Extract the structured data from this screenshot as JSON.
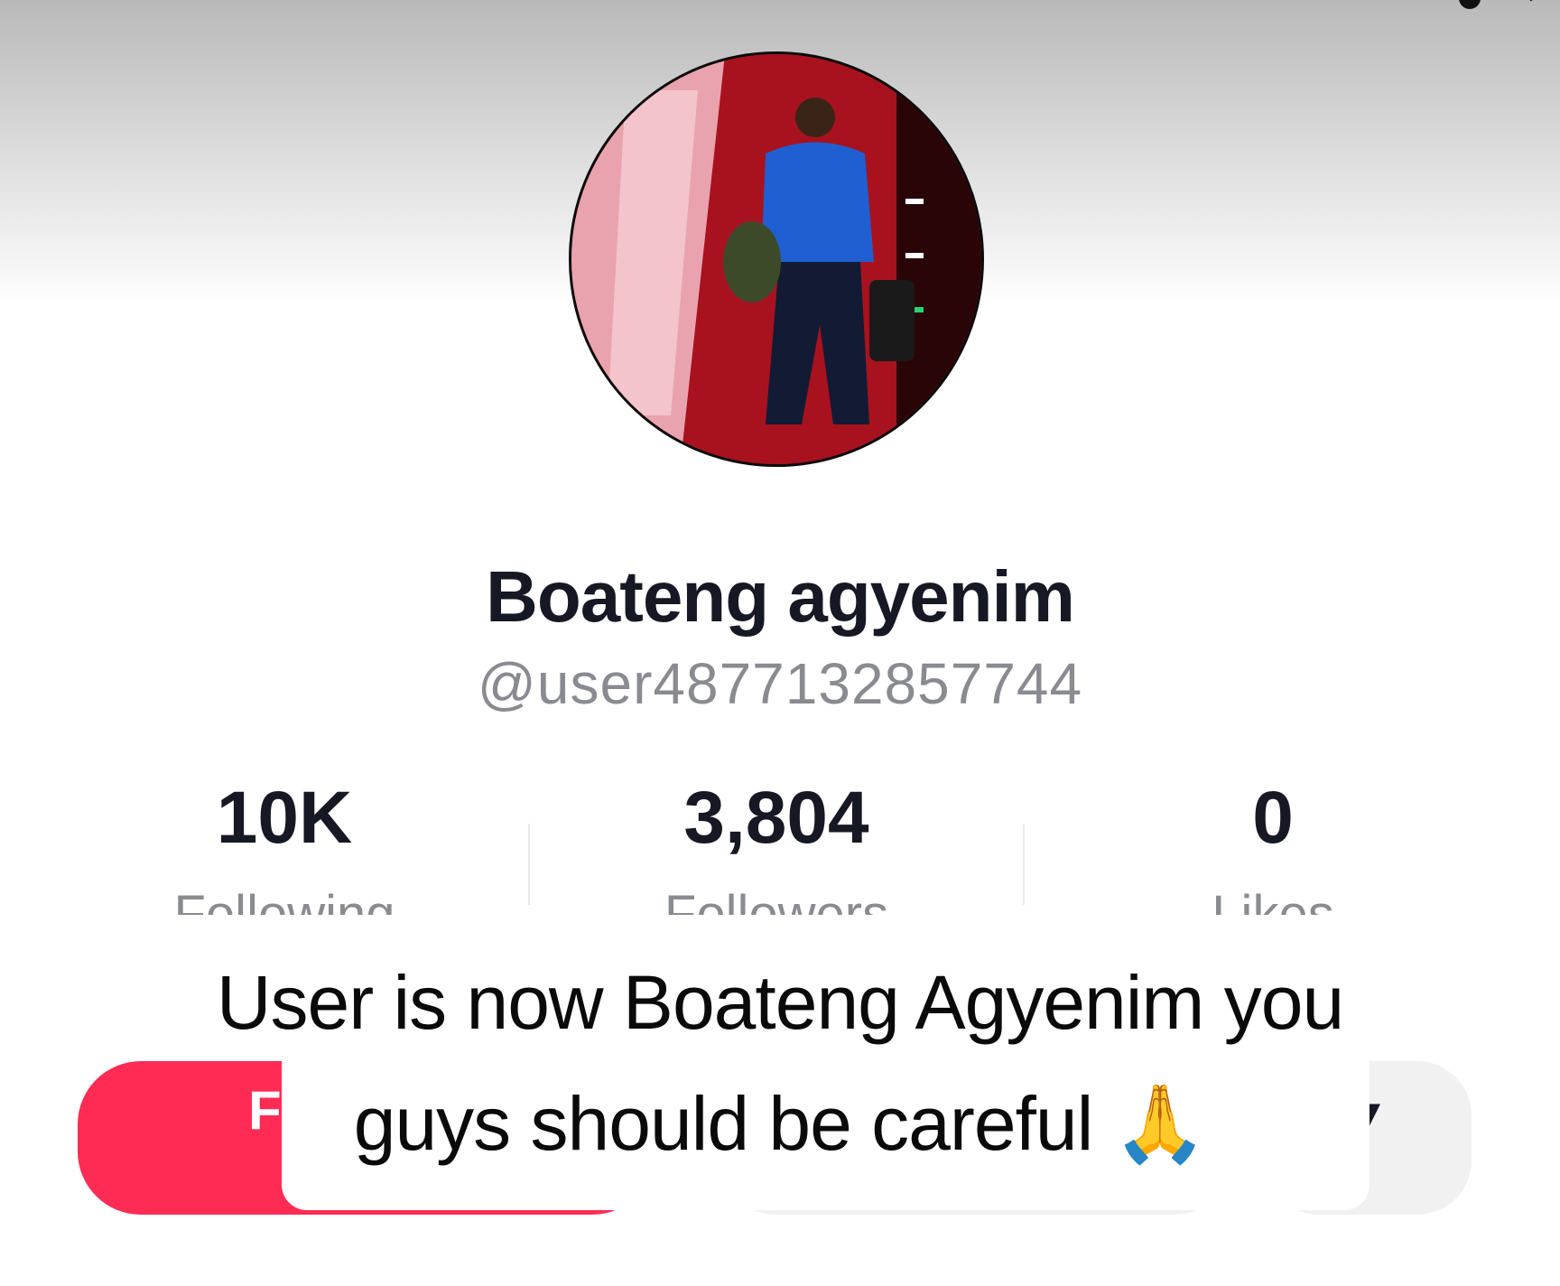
{
  "profile": {
    "display_name": "Boateng agyenim",
    "handle": "@user4877132857744"
  },
  "stats": [
    {
      "value": "10K",
      "label": "Following"
    },
    {
      "value": "3,804",
      "label": "Followers"
    },
    {
      "value": "0",
      "label": "Likes"
    }
  ],
  "buttons": {
    "follow_peek": "F",
    "more_peek": "▾"
  },
  "caption": {
    "line1": "User is now Boateng Agyenim you",
    "line2": "guys should be careful",
    "emoji": "🙏"
  },
  "colors": {
    "follow_button": "#fe2c55",
    "secondary_button": "#f1f1f2",
    "primary_text": "#161823",
    "secondary_text": "#8a8b91"
  }
}
